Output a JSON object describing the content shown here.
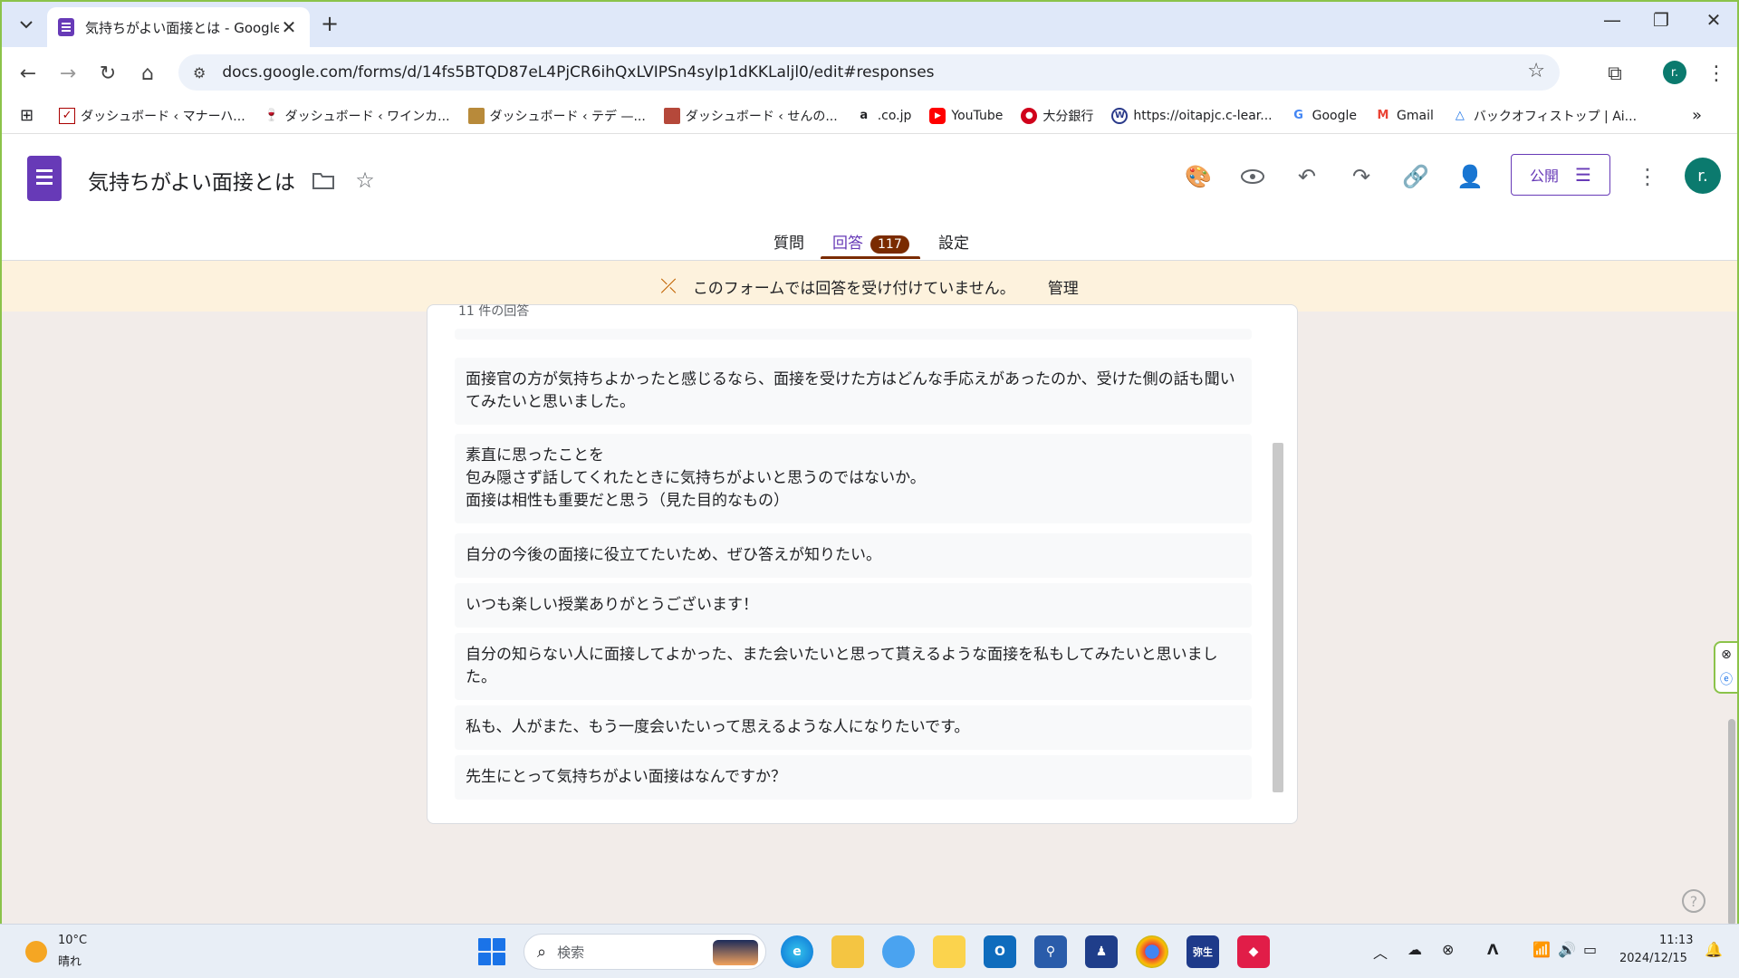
{
  "browser": {
    "tab_title": "気持ちがよい面接とは - Google フ",
    "url": "docs.google.com/forms/d/14fs5BTQD87eL4PjCR6ihQxLVIPSn4syIp1dKKLaljl0/edit#responses",
    "profile_initial": "r."
  },
  "bookmarks": [
    {
      "label": "ダッシュボード ‹ マナーハ...",
      "icon": "checkbox-icon"
    },
    {
      "label": "ダッシュボード ‹ ワインカ...",
      "icon": "wine-icon"
    },
    {
      "label": "ダッシュボード ‹ テデ —...",
      "icon": "folder-icon"
    },
    {
      "label": "ダッシュボード ‹ せんの...",
      "icon": "site-icon"
    },
    {
      "label": ".co.jp",
      "icon": "amazon-icon"
    },
    {
      "label": "YouTube",
      "icon": "youtube-icon"
    },
    {
      "label": "大分銀行",
      "icon": "bank-icon"
    },
    {
      "label": "https://oitapjc.c-lear...",
      "icon": "globe-icon"
    },
    {
      "label": "Google",
      "icon": "google-icon"
    },
    {
      "label": "Gmail",
      "icon": "gmail-icon"
    },
    {
      "label": "バックオフィストップ | Ai...",
      "icon": "drive-icon"
    }
  ],
  "forms": {
    "doc_title": "気持ちがよい面接とは",
    "publish_label": "公開",
    "avatar_initial": "r.",
    "tabs": [
      {
        "label": "質問"
      },
      {
        "label": "回答",
        "badge": "117"
      },
      {
        "label": "設定"
      }
    ]
  },
  "notice": {
    "text": "このフォームでは回答を受け付けていません。",
    "manage": "管理"
  },
  "responses": {
    "partial_header": "11 件の回答",
    "items": [
      "面接官の方が気持ちよかったと感じるなら、面接を受けた方はどんな手応えがあったのか、受けた側の話も聞いてみたいと思いました。",
      "素直に思ったことを\n包み隠さず話してくれたときに気持ちがよいと思うのではないか。\n面接は相性も重要だと思う（見た目的なもの）",
      "自分の今後の面接に役立てたいため、ぜひ答えが知りたい。",
      "いつも楽しい授業ありがとうございます！",
      "自分の知らない人に面接してよかった、また会いたいと思って貰えるような面接を私もしてみたいと思いました。",
      "私も、人がまた、もう一度会いたいって思えるような人になりたいです。",
      "先生にとって気持ちがよい面接はなんですか？"
    ]
  },
  "taskbar": {
    "weather_temp": "10°C",
    "weather_desc": "晴れ",
    "search_placeholder": "検索",
    "time": "11:13",
    "date": "2024/12/15"
  }
}
